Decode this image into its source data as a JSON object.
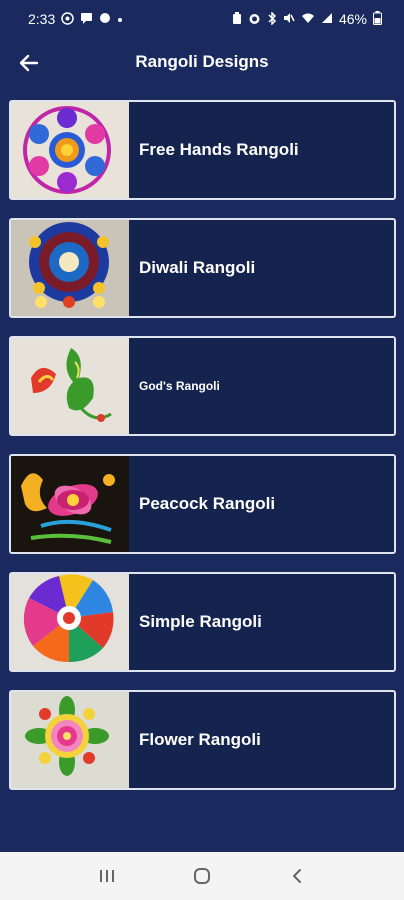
{
  "status": {
    "time": "2:33",
    "battery": "46%",
    "left_icons": [
      "whatsapp-icon",
      "message-icon",
      "notification-icon",
      "dot-icon"
    ],
    "right_icons": [
      "battery-saver-icon",
      "alarm-icon",
      "bluetooth-icon",
      "mute-icon",
      "wifi-icon",
      "signal-icon",
      "battery-icon"
    ]
  },
  "app_bar": {
    "title": "Rangoli Designs",
    "back_icon": "arrow-left-icon"
  },
  "items": [
    {
      "label": "Free Hands Rangoli"
    },
    {
      "label": "Diwali Rangoli"
    },
    {
      "label": "God's Rangoli"
    },
    {
      "label": "Peacock Rangoli"
    },
    {
      "label": "Simple Rangoli"
    },
    {
      "label": "Flower Rangoli"
    }
  ],
  "nav": {
    "recents_icon": "recents-icon",
    "home_icon": "home-icon",
    "back_icon": "back-chevron-icon"
  },
  "colors": {
    "background": "#1a2a5e",
    "card": "#15234f",
    "card_border": "#dfe3ee",
    "nav_bar": "#f4f4f4"
  }
}
